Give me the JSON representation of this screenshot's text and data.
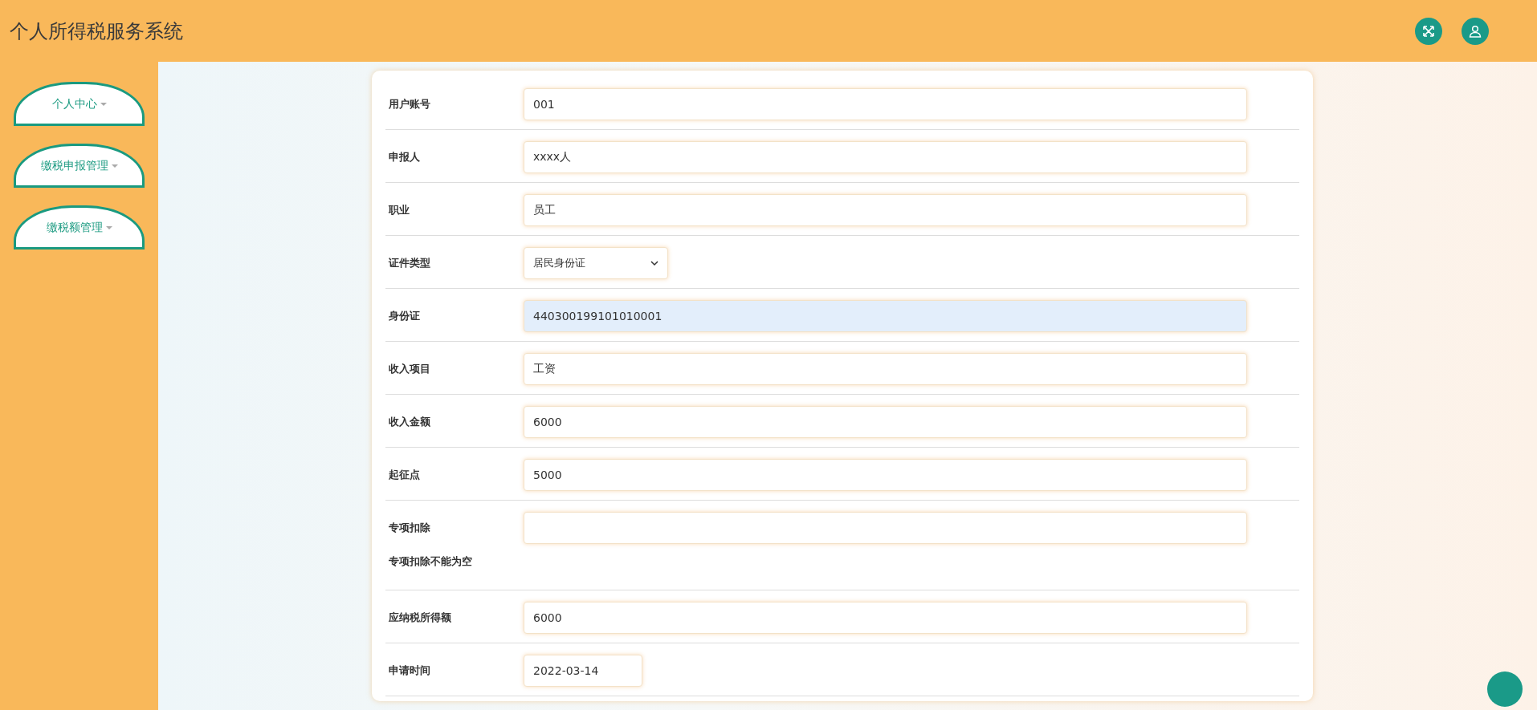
{
  "header": {
    "title": "个人所得税服务系统"
  },
  "sidebar": {
    "items": [
      {
        "label": "个人中心"
      },
      {
        "label": "缴税申报管理"
      },
      {
        "label": "缴税额管理"
      }
    ]
  },
  "form": {
    "fields": [
      {
        "label": "用户账号",
        "kind": "text",
        "value": "001",
        "highlighted": false
      },
      {
        "label": "申报人",
        "kind": "text",
        "value": "xxxx人",
        "highlighted": false
      },
      {
        "label": "职业",
        "kind": "text",
        "value": "员工",
        "highlighted": false
      },
      {
        "label": "证件类型",
        "kind": "select",
        "value": "居民身份证",
        "highlighted": false
      },
      {
        "label": "身份证",
        "kind": "text",
        "value": "440300199101010001",
        "highlighted": true
      },
      {
        "label": "收入项目",
        "kind": "text",
        "value": "工资",
        "highlighted": false
      },
      {
        "label": "收入金额",
        "kind": "text",
        "value": "6000",
        "highlighted": false
      },
      {
        "label": "起征点",
        "kind": "text",
        "value": "5000",
        "highlighted": false
      },
      {
        "label": "专项扣除",
        "kind": "text",
        "error": "专项扣除不能为空",
        "highlighted": false
      },
      {
        "label": "应纳税所得额",
        "kind": "text",
        "value": "6000",
        "highlighted": false
      },
      {
        "label": "申请时间",
        "kind": "date",
        "value": "2022-03-14",
        "highlighted": false
      }
    ]
  }
}
